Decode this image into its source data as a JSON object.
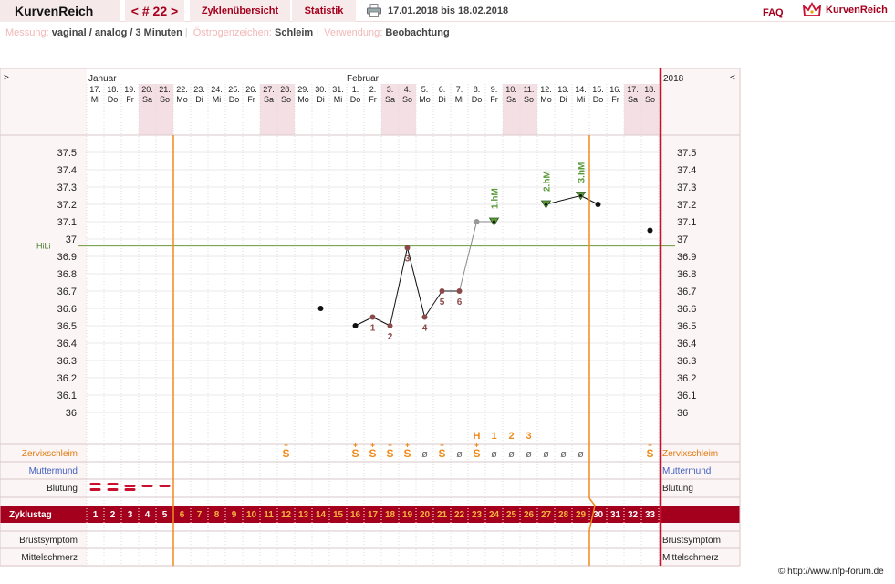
{
  "topbar": {
    "brand": "KurvenReich",
    "cycle_nav": "< # 22 >",
    "overview": "Zyklenübersicht",
    "statistics": "Statistik",
    "date_range": "17.01.2018 bis 18.02.2018",
    "faq": "FAQ",
    "logo_text": "KurvenReich"
  },
  "meta": {
    "messung_label": "Messung:",
    "messung_value": "vaginal / analog / 3 Minuten",
    "oestrogen_label": "Östrogenzeichen:",
    "oestrogen_value": "Schleim",
    "verwendung_label": "Verwendung:",
    "verwendung_value": "Beobachtung"
  },
  "chart_data": {
    "type": "nfp-cycle-chart",
    "left_toggle": ">",
    "right_toggle": "<",
    "month_left": "Januar",
    "month_mid": "Februar",
    "year": "2018",
    "day_numbers": [
      "17.",
      "18.",
      "19.",
      "20.",
      "21.",
      "22.",
      "23.",
      "24.",
      "25.",
      "26.",
      "27.",
      "28.",
      "29.",
      "30.",
      "31.",
      "1.",
      "2.",
      "3.",
      "4.",
      "5.",
      "6.",
      "7.",
      "8.",
      "9.",
      "10.",
      "11.",
      "12.",
      "13.",
      "14.",
      "15.",
      "16.",
      "17.",
      "18."
    ],
    "weekdays": [
      "Mi",
      "Do",
      "Fr",
      "Sa",
      "So",
      "Mo",
      "Di",
      "Mi",
      "Do",
      "Fr",
      "Sa",
      "So",
      "Mo",
      "Di",
      "Mi",
      "Do",
      "Fr",
      "Sa",
      "So",
      "Mo",
      "Di",
      "Mi",
      "Do",
      "Fr",
      "Sa",
      "So",
      "Mo",
      "Di",
      "Mi",
      "Do",
      "Fr",
      "Sa",
      "So"
    ],
    "weekend_days": [
      4,
      5,
      11,
      12,
      18,
      19,
      25,
      26,
      32,
      33
    ],
    "y_ticks": [
      "37.5",
      "37.4",
      "37.3",
      "37.2",
      "37.1",
      "37",
      "36.9",
      "36.8",
      "36.7",
      "36.6",
      "36.5",
      "36.4",
      "36.3",
      "36.2",
      "36.1",
      "36"
    ],
    "ylim": [
      36.0,
      37.5
    ],
    "hili_label": "HiLi",
    "hili_value": 36.96,
    "temperatures": [
      {
        "day": 14,
        "temp": 36.6,
        "kind": "excluded"
      },
      {
        "day": 16,
        "temp": 36.5,
        "kind": "normal"
      },
      {
        "day": 17,
        "temp": 36.55,
        "kind": "lower",
        "label": "1"
      },
      {
        "day": 18,
        "temp": 36.5,
        "kind": "lower",
        "label": "2"
      },
      {
        "day": 19,
        "temp": 36.95,
        "kind": "lower",
        "label": "3"
      },
      {
        "day": 20,
        "temp": 36.55,
        "kind": "lower",
        "label": "4"
      },
      {
        "day": 21,
        "temp": 36.7,
        "kind": "lower",
        "label": "5"
      },
      {
        "day": 22,
        "temp": 36.7,
        "kind": "lower",
        "label": "6"
      },
      {
        "day": 23,
        "temp": 37.1,
        "kind": "grey"
      },
      {
        "day": 24,
        "temp": 37.1,
        "kind": "higher",
        "label": "1.hM"
      },
      {
        "day": 27,
        "temp": 37.2,
        "kind": "higher",
        "label": "2.hM"
      },
      {
        "day": 29,
        "temp": 37.25,
        "kind": "higher",
        "label": "3.hM"
      },
      {
        "day": 30,
        "temp": 37.2,
        "kind": "normal"
      },
      {
        "day": 33,
        "temp": 37.05,
        "kind": "excluded"
      }
    ],
    "mucus_hcount": [
      {
        "day": 23,
        "text": "H"
      },
      {
        "day": 24,
        "text": "1"
      },
      {
        "day": 25,
        "text": "2"
      },
      {
        "day": 26,
        "text": "3"
      }
    ],
    "rows": {
      "mucus": "Zervixschleim",
      "cervix": "Muttermund",
      "bleeding": "Blutung",
      "cycle_day": "Zyklustag",
      "breast": "Brustsymptom",
      "midpain": "Mittelschmerz"
    },
    "mucus_entries": [
      {
        "day": 12,
        "sym": "S+"
      },
      {
        "day": 16,
        "sym": "S+"
      },
      {
        "day": 17,
        "sym": "S+"
      },
      {
        "day": 18,
        "sym": "S+"
      },
      {
        "day": 19,
        "sym": "S+"
      },
      {
        "day": 20,
        "sym": "ø"
      },
      {
        "day": 21,
        "sym": "S+"
      },
      {
        "day": 22,
        "sym": "ø"
      },
      {
        "day": 23,
        "sym": "S+"
      },
      {
        "day": 24,
        "sym": "ø"
      },
      {
        "day": 25,
        "sym": "ø"
      },
      {
        "day": 26,
        "sym": "ø"
      },
      {
        "day": 27,
        "sym": "ø"
      },
      {
        "day": 28,
        "sym": "ø"
      },
      {
        "day": 29,
        "sym": "ø"
      },
      {
        "day": 33,
        "sym": "S+"
      }
    ],
    "bleeding": [
      {
        "day": 1,
        "strength": 3
      },
      {
        "day": 2,
        "strength": 3
      },
      {
        "day": 3,
        "strength": 2
      },
      {
        "day": 4,
        "strength": 1
      },
      {
        "day": 5,
        "strength": 1
      }
    ],
    "cycle_days": [
      "1",
      "2",
      "3",
      "4",
      "5",
      "6",
      "7",
      "8",
      "9",
      "10",
      "11",
      "12",
      "13",
      "14",
      "15",
      "16",
      "17",
      "18",
      "19",
      "20",
      "21",
      "22",
      "23",
      "24",
      "25",
      "26",
      "27",
      "28",
      "29",
      "30",
      "31",
      "32",
      "33"
    ],
    "fertile_start_day": 5,
    "fertile_end_day": 29
  },
  "copyright": "© http://www.nfp-forum.de"
}
